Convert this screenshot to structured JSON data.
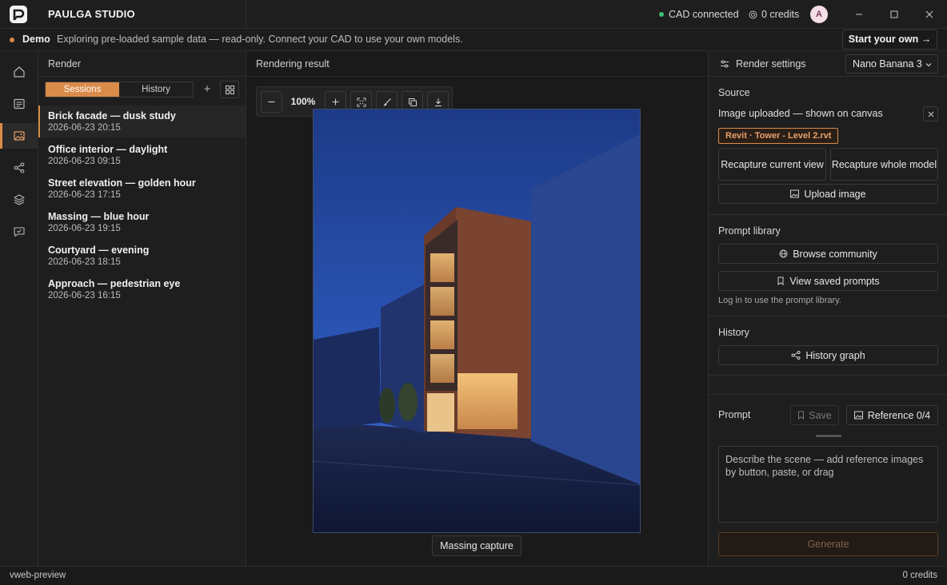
{
  "app": {
    "brand": "PAULGA STUDIO"
  },
  "titlebar": {
    "cad_status": "CAD connected",
    "credits": "0 credits",
    "avatar_initial": "A"
  },
  "demo": {
    "label": "Demo",
    "text": "Exploring pre-loaded sample data — read-only. Connect your CAD to use your own models.",
    "cta": "Start your own →"
  },
  "rail": {
    "items": [
      "home-icon",
      "document-icon",
      "image-icon",
      "share-icon",
      "layers-icon",
      "feedback-icon"
    ],
    "active": "image-icon"
  },
  "render_panel": {
    "title": "Render",
    "tabs": [
      {
        "label": "Sessions",
        "active": true
      },
      {
        "label": "History",
        "active": false
      }
    ],
    "add_label": "+",
    "sessions": [
      {
        "name": "Brick facade — dusk study",
        "date": "2026-06-23 20:15",
        "active": true
      },
      {
        "name": "Office interior — daylight",
        "date": "2026-06-23 09:15"
      },
      {
        "name": "Street elevation — golden hour",
        "date": "2026-06-23 17:15"
      },
      {
        "name": "Massing — blue hour",
        "date": "2026-06-23 19:15"
      },
      {
        "name": "Courtyard — evening",
        "date": "2026-06-23 18:15"
      },
      {
        "name": "Approach — pedestrian eye",
        "date": "2026-06-23 16:15"
      }
    ]
  },
  "canvas": {
    "title": "Rendering result",
    "zoom": "100%",
    "caption": "Massing capture"
  },
  "settings": {
    "title": "Render settings",
    "model": "Nano Banana 3",
    "source": {
      "title": "Source",
      "status": "Image uploaded — shown on canvas",
      "file_tag": "Revit · Tower - Level 2.rvt",
      "recapture_view": "Recapture current view",
      "recapture_model": "Recapture whole model",
      "upload": "Upload image"
    },
    "prompt_library": {
      "title": "Prompt library",
      "browse": "Browse community",
      "saved": "View saved prompts",
      "note": "Log in to use the prompt library."
    },
    "history": {
      "title": "History",
      "graph": "History graph"
    },
    "prompt": {
      "title": "Prompt",
      "save": "Save",
      "reference": "Reference 0/4",
      "placeholder": "Describe the scene — add reference images by button, paste, or drag",
      "generate": "Generate"
    }
  },
  "statusbar": {
    "left": "vweb-preview",
    "right": "0 credits"
  },
  "colors": {
    "accent": "#d98b4a",
    "connected": "#3fbf6f",
    "background": "#1c1c1c"
  }
}
